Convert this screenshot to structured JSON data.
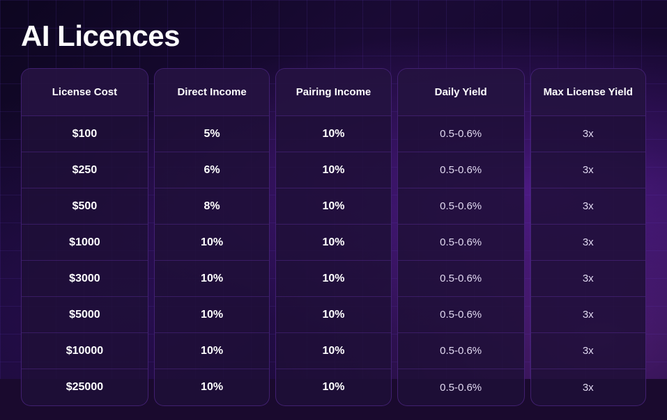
{
  "page": {
    "title": "AI Licences"
  },
  "columns": [
    {
      "id": "license-cost",
      "header": "License Cost",
      "type": "bold",
      "values": [
        "$100",
        "$250",
        "$500",
        "$1000",
        "$3000",
        "$5000",
        "$10000",
        "$25000"
      ]
    },
    {
      "id": "direct-income",
      "header": "Direct Income",
      "type": "bold",
      "values": [
        "5%",
        "6%",
        "8%",
        "10%",
        "10%",
        "10%",
        "10%",
        "10%"
      ]
    },
    {
      "id": "pairing-income",
      "header": "Pairing Income",
      "type": "bold",
      "values": [
        "10%",
        "10%",
        "10%",
        "10%",
        "10%",
        "10%",
        "10%",
        "10%"
      ]
    },
    {
      "id": "daily-yield",
      "header": "Daily Yield",
      "type": "light",
      "values": [
        "0.5-0.6%",
        "0.5-0.6%",
        "0.5-0.6%",
        "0.5-0.6%",
        "0.5-0.6%",
        "0.5-0.6%",
        "0.5-0.6%",
        "0.5-0.6%"
      ]
    },
    {
      "id": "max-license-yield",
      "header": "Max License Yield",
      "type": "light",
      "values": [
        "3x",
        "3x",
        "3x",
        "3x",
        "3x",
        "3x",
        "3x",
        "3x"
      ]
    }
  ]
}
